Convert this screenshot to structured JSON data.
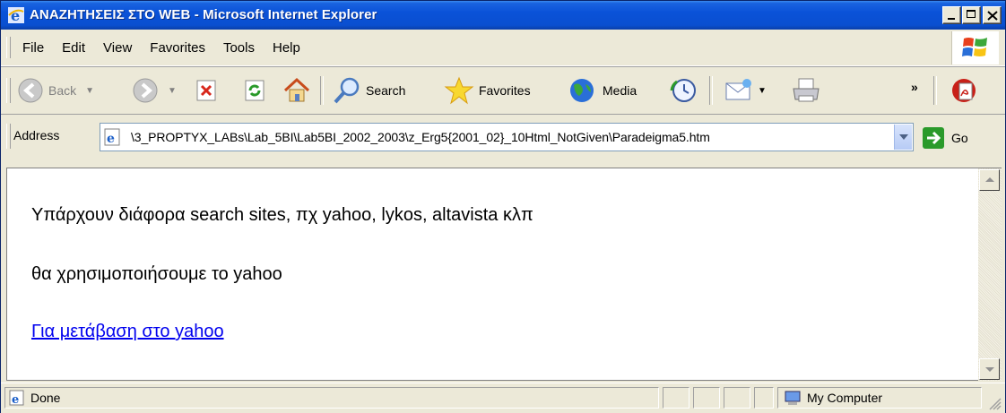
{
  "window": {
    "title": "ΑΝΑΖΗΤΗΣΕΙΣ ΣΤΟ WEB - Microsoft Internet Explorer"
  },
  "menu": {
    "items": [
      "File",
      "Edit",
      "View",
      "Favorites",
      "Tools",
      "Help"
    ]
  },
  "toolbar": {
    "back_label": "Back",
    "search_label": "Search",
    "favorites_label": "Favorites",
    "media_label": "Media",
    "overflow_label": "»"
  },
  "address": {
    "label": "Address",
    "value": "\\3_PROPTYX_LABs\\Lab_5BI\\Lab5BI_2002_2003\\z_Erg5{2001_02}_10Html_NotGiven\\Paradeigma5.htm",
    "go_label": "Go"
  },
  "content": {
    "line1": "Υπάρχουν διάφορα search sites, πχ yahoo, lykos, altavista κλπ",
    "line2": "θα χρησιμοποιήσουμε το yahoo",
    "link": "Για μετάβαση στο yahoo"
  },
  "status": {
    "text": "Done",
    "zone": "My Computer"
  },
  "colors": {
    "titlebar": "#0a52d8",
    "link": "#0000ee",
    "chrome": "#ece9d8"
  }
}
